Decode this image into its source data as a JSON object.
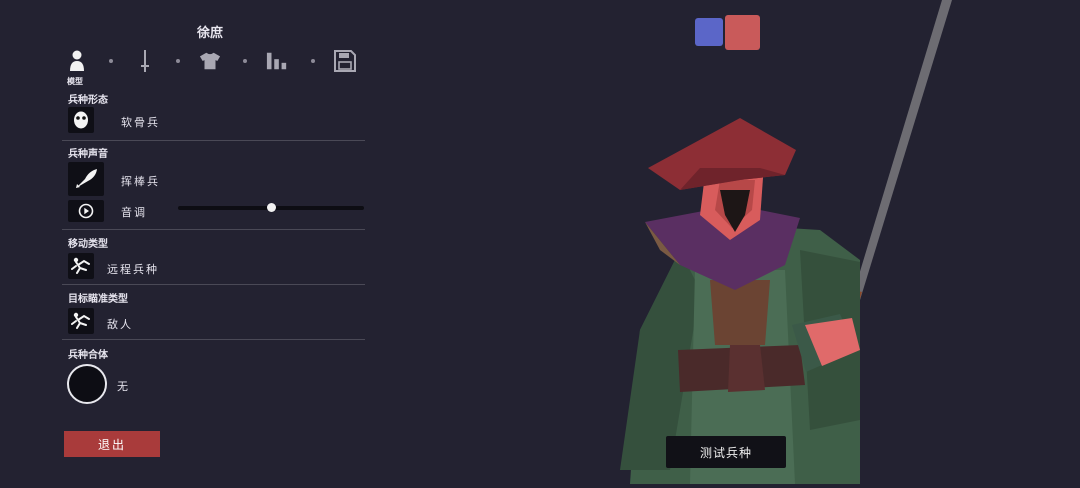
{
  "unit": {
    "name": "徐庶"
  },
  "tabs": [
    {
      "icon": "person-icon",
      "label": "模型"
    },
    {
      "icon": "sword-icon"
    },
    {
      "icon": "shirt-icon"
    },
    {
      "icon": "bar-chart-icon"
    },
    {
      "icon": "save-icon"
    }
  ],
  "sections": {
    "form": {
      "title": "兵种形态",
      "value": "软骨兵",
      "icon": "mask-icon"
    },
    "voice": {
      "title": "兵种声音",
      "value": "挥棒兵",
      "icon": "voice-icon",
      "pitch_label": "音调",
      "pitch_fraction": 0.5
    },
    "movement": {
      "title": "移动类型",
      "value": "远程兵种",
      "icon": "movement-icon"
    },
    "targeting": {
      "title": "目标瞄准类型",
      "value": "敌人",
      "icon": "target-icon"
    },
    "combine": {
      "title": "兵种合体",
      "value": "无"
    }
  },
  "buttons": {
    "exit": "退出",
    "test": "测试兵种"
  },
  "team_colors": [
    "#5b66c8",
    "#c95a5a"
  ],
  "colors": {
    "background": "#232231",
    "exit_button": "#a93b3b"
  }
}
